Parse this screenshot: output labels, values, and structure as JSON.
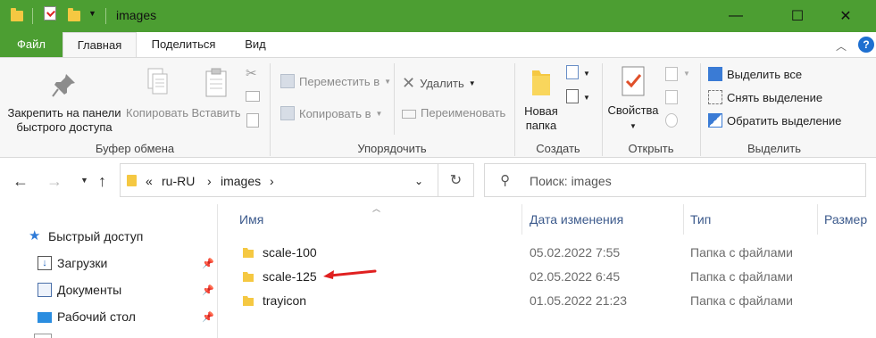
{
  "window": {
    "title": "images",
    "controls": {
      "minimize": "—",
      "maximize": "☐",
      "close": "✕"
    }
  },
  "ribbon_tabs": {
    "file": "Файл",
    "home": "Главная",
    "share": "Поделиться",
    "view": "Вид",
    "help": "?"
  },
  "clipboard": {
    "pin_label_1": "Закрепить на панели",
    "pin_label_2": "быстрого доступа",
    "copy": "Копировать",
    "paste": "Вставить",
    "group": "Буфер обмена"
  },
  "organize": {
    "move_to": "Переместить в",
    "copy_to": "Копировать в",
    "delete": "Удалить",
    "rename": "Переименовать",
    "group": "Упорядочить"
  },
  "new": {
    "new_folder_1": "Новая",
    "new_folder_2": "папка",
    "group": "Создать"
  },
  "open": {
    "properties": "Свойства",
    "group": "Открыть"
  },
  "select": {
    "select_all": "Выделить все",
    "select_none": "Снять выделение",
    "invert": "Обратить выделение",
    "group": "Выделить"
  },
  "address": {
    "overflow": "«",
    "crumbs": [
      "ru-RU",
      "images"
    ],
    "search_placeholder": "Поиск: images"
  },
  "nav_pane": {
    "quick_access": "Быстрый доступ",
    "items": [
      "Загрузки",
      "Документы",
      "Рабочий стол"
    ]
  },
  "columns": {
    "name": "Имя",
    "date": "Дата изменения",
    "type": "Тип",
    "size": "Размер"
  },
  "files": [
    {
      "name": "scale-100",
      "date": "05.02.2022 7:55",
      "type": "Папка с файлами"
    },
    {
      "name": "scale-125",
      "date": "02.05.2022 6:45",
      "type": "Папка с файлами"
    },
    {
      "name": "trayicon",
      "date": "01.05.2022 21:23",
      "type": "Папка с файлами"
    }
  ],
  "colors": {
    "titlebar": "#4c9e32",
    "folder": "#f5c842",
    "annotation_arrow": "#e02020"
  }
}
